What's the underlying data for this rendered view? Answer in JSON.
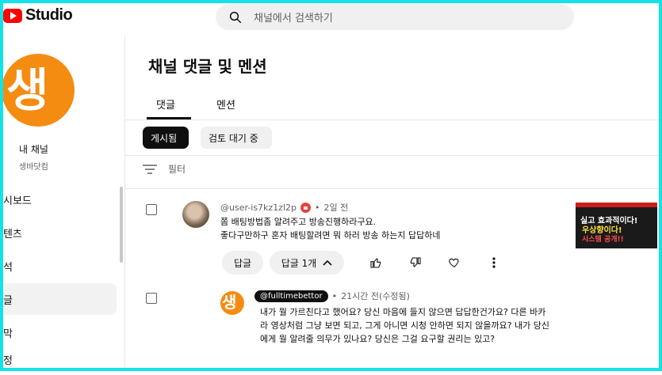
{
  "header": {
    "logo_text": "Studio",
    "search_placeholder": "채널에서 검색하기"
  },
  "sidebar": {
    "channel_title": "내 채널",
    "channel_name": "생바닷컴",
    "avatar_glyph": "생",
    "nav": [
      {
        "label": "대시보드",
        "visible": "시보드"
      },
      {
        "label": "콘텐츠",
        "visible": "콘텐츠"
      },
      {
        "label": "분석",
        "visible": "분석"
      },
      {
        "label": "댓글",
        "visible": "댓글"
      },
      {
        "label": "자막",
        "visible": "자막"
      },
      {
        "label": "설정",
        "visible": "설정"
      }
    ]
  },
  "main": {
    "title": "채널 댓글 및 멘션",
    "tabs": [
      "댓글",
      "멘션"
    ],
    "chips": [
      "게시됨",
      "검토 대기 중"
    ],
    "filter_label": "필터"
  },
  "comments": [
    {
      "author": "@user-is7kz1zl2p",
      "time": "2일 전",
      "lines": [
        "쫌 배팅방법좀 알려주고 방송진행하라구요.",
        "좋다구만하구 혼자 배팅할려면 뭐 하러 방송 하는지  답답하네"
      ],
      "reply_label": "답글",
      "replies_label": "답글 1개",
      "thumbnail": {
        "line1": "실고 효과적이다!",
        "line2": "우상향이다!",
        "line3": "시스템 공개!!"
      }
    },
    {
      "author": "@fulltimebettor",
      "time": "21시간 전(수정됨)",
      "avatar_glyph": "생",
      "lines": [
        "내가 뭘 가르친다고 했어요? 당신 마음에 들지 않으면 답답한건가요? 다른 바카",
        "라 영상처럼 그냥 보면 되고, 그게 아니면 시청 안하면 되지 않을까요? 내가 당신",
        "에게 뭘 알려줄 의무가 있나요? 당신은 그걸 요구할 권리는 있고?"
      ]
    }
  ],
  "colors": {
    "accent": "#13e2e6",
    "brand": "#ff0000",
    "avatar_orange": "#f48c12"
  }
}
